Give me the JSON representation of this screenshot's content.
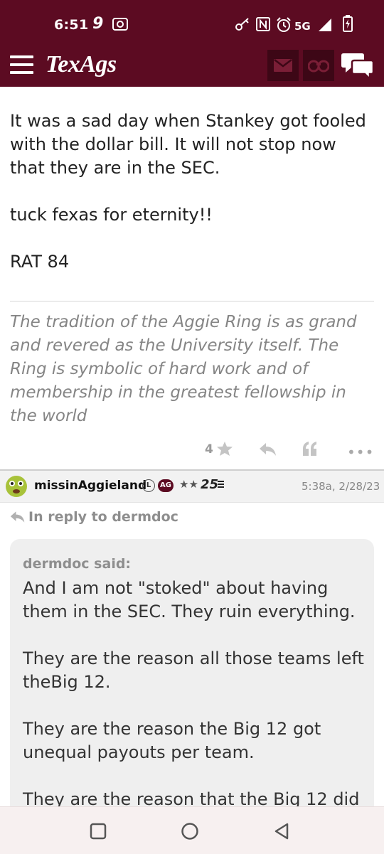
{
  "status_bar": {
    "time": "6:51",
    "notif_digit": "9",
    "network": "5G"
  },
  "app_bar": {
    "logo": "TexAgs",
    "icons": [
      "menu-icon",
      "mail-icon",
      "binoculars-icon",
      "chat-icon"
    ]
  },
  "post": {
    "paragraphs": [
      "It was a sad day when Stankey got fooled with the dollar bill. It will not stop now that they are in the SEC.",
      "tuck fexas for eternity!!",
      "RAT 84"
    ],
    "signature": "The tradition of the Aggie Ring is as grand and revered as the University itself. The Ring is symbolic of hard work and of membership in the greatest fellowship in the world",
    "star_count": "4"
  },
  "reply": {
    "username": "missinAggieland",
    "badge_l": "L",
    "badge_ag": "AG",
    "stars": "★★",
    "level": "25",
    "timestamp": "5:38a, 2/28/23",
    "in_reply_to": "In reply to dermdoc",
    "quote_author": "dermdoc said:",
    "quote_paragraphs": [
      "And I am not \"stoked\" about having them in the SEC. They ruin everything.",
      "They are the reason all those teams left theBig 12.",
      "They are the reason the Big 12 got unequal payouts per team.",
      "They are the reason that the Big 12 did"
    ]
  },
  "colors": {
    "brand": "#5c0b22",
    "brand_dark": "#3d0716",
    "text": "#222222",
    "muted": "#858585"
  }
}
